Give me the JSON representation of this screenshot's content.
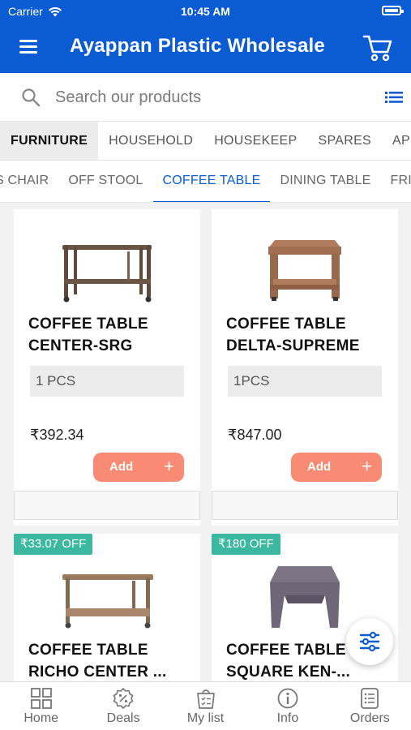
{
  "status": {
    "carrier": "Carrier",
    "time": "10:45 AM"
  },
  "header": {
    "title": "Ayappan Plastic Wholesale"
  },
  "search": {
    "placeholder": "Search our products"
  },
  "categories": [
    "FURNITURE",
    "HOUSEHOLD",
    "HOUSEKEEP",
    "SPARES",
    "APPLI"
  ],
  "active_category": "FURNITURE",
  "subcategories": [
    "S CHAIR",
    "OFF STOOL",
    "COFFEE TABLE",
    "DINING TABLE",
    "FRIDG"
  ],
  "active_subcategory": "COFFEE TABLE",
  "products": [
    {
      "name": "COFFEE TABLE CENTER-SRG",
      "qty": "1 PCS",
      "price": "₹392.34",
      "add_label": "Add",
      "add_symbol": "+"
    },
    {
      "name": "COFFEE TABLE DELTA-SUPREME",
      "qty": "1PCS",
      "price": "₹847.00",
      "add_label": "Add",
      "add_symbol": "+"
    },
    {
      "name": "COFFEE TABLE RICHO CENTER ...",
      "badge": "₹33.07 OFF"
    },
    {
      "name": "COFFEE TABLE SQUARE KEN-...",
      "badge": "₹180 OFF"
    }
  ],
  "bottom_nav": [
    {
      "label": "Home",
      "icon": "grid-icon"
    },
    {
      "label": "Deals",
      "icon": "deals-badge-icon"
    },
    {
      "label": "My list",
      "icon": "shopping-bag-list-icon"
    },
    {
      "label": "Info",
      "icon": "info-icon"
    },
    {
      "label": "Orders",
      "icon": "orders-list-icon"
    }
  ],
  "colors": {
    "brand": "#0b5bd3",
    "add_button": "#f98a73",
    "offer_badge": "#3cb8a0",
    "active_tab": "#0b5bd3"
  }
}
